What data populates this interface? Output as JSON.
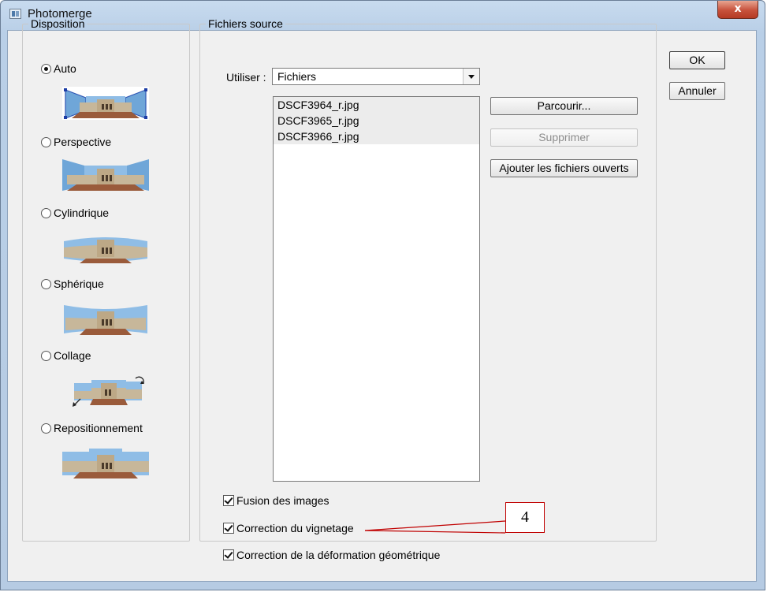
{
  "window": {
    "title": "Photomerge",
    "close_label": "x"
  },
  "disposition": {
    "legend": "Disposition",
    "options": [
      {
        "label": "Auto",
        "selected": true
      },
      {
        "label": "Perspective",
        "selected": false
      },
      {
        "label": "Cylindrique",
        "selected": false
      },
      {
        "label": "Sphérique",
        "selected": false
      },
      {
        "label": "Collage",
        "selected": false
      },
      {
        "label": "Repositionnement",
        "selected": false
      }
    ]
  },
  "source": {
    "legend": "Fichiers source",
    "use_label": "Utiliser :",
    "use_value": "Fichiers",
    "files": [
      "DSCF3964_r.jpg",
      "DSCF3965_r.jpg",
      "DSCF3966_r.jpg"
    ],
    "browse_label": "Parcourir...",
    "remove_label": "Supprimer",
    "add_open_label": "Ajouter les fichiers ouverts",
    "checkboxes": [
      {
        "label": "Fusion des images",
        "checked": true
      },
      {
        "label": "Correction du vignetage",
        "checked": true
      },
      {
        "label": "Correction de la déformation géométrique",
        "checked": true
      }
    ]
  },
  "buttons": {
    "ok": "OK",
    "cancel": "Annuler"
  },
  "annotation": {
    "number": "4",
    "color": "#c00000"
  }
}
